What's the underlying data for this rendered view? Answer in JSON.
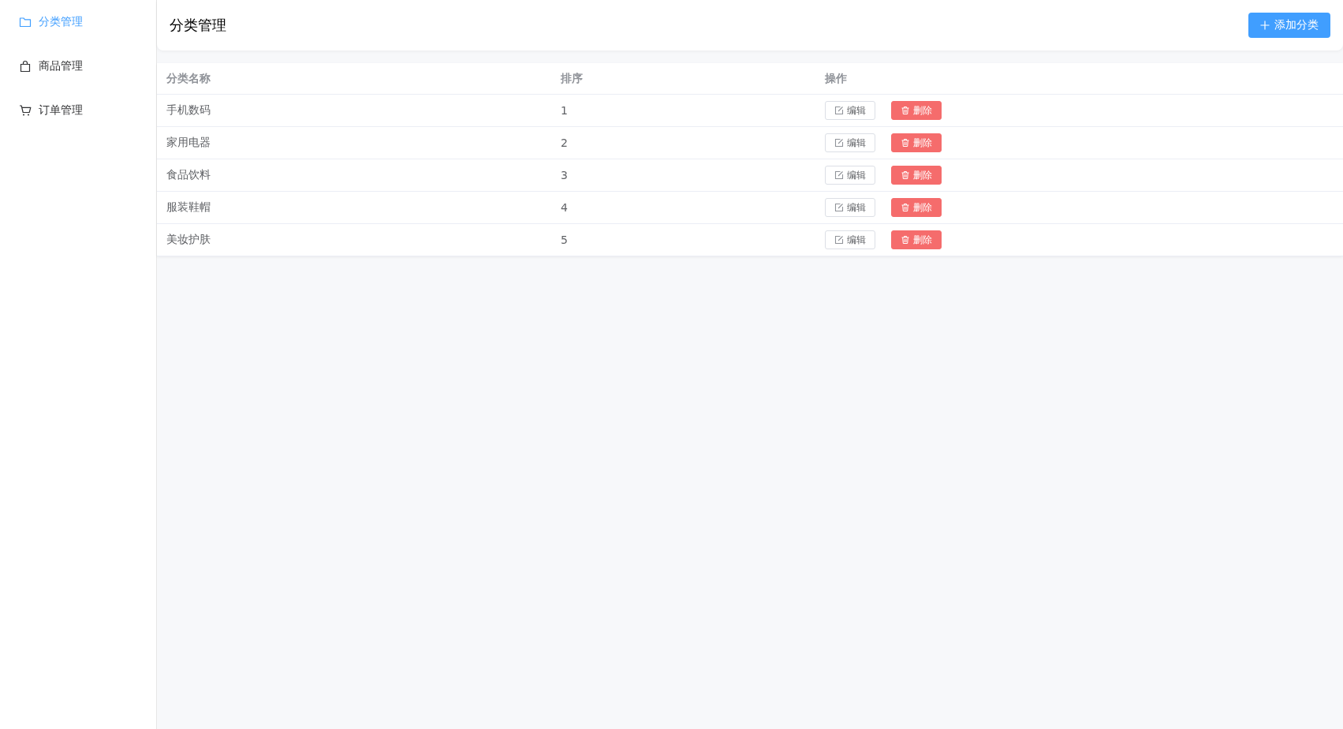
{
  "sidebar": {
    "items": [
      {
        "label": "分类管理",
        "selected": true
      },
      {
        "label": "商品管理",
        "selected": false
      },
      {
        "label": "订单管理",
        "selected": false
      }
    ]
  },
  "header": {
    "title": "分类管理",
    "add_button": "添加分类"
  },
  "table": {
    "columns": [
      "分类名称",
      "排序",
      "操作"
    ],
    "rows": [
      {
        "name": "手机数码",
        "sort": "1",
        "actions": [
          {
            "kind": "edit",
            "label": "编辑"
          },
          {
            "kind": "delete",
            "label": "删除"
          }
        ]
      },
      {
        "name": "家用电器",
        "sort": "2",
        "actions": [
          {
            "kind": "edit",
            "label": "编辑"
          },
          {
            "kind": "delete",
            "label": "删除"
          }
        ]
      },
      {
        "name": "食品饮料",
        "sort": "3",
        "actions": [
          {
            "kind": "edit",
            "label": "编辑"
          },
          {
            "kind": "delete",
            "label": "删除"
          }
        ]
      },
      {
        "name": "服装鞋帽",
        "sort": "4",
        "actions": [
          {
            "kind": "edit",
            "label": "编辑"
          },
          {
            "kind": "delete",
            "label": "删除"
          }
        ]
      },
      {
        "name": "美妆护肤",
        "sort": "5",
        "actions": [
          {
            "kind": "edit",
            "label": "编辑"
          },
          {
            "kind": "delete",
            "label": "删除"
          }
        ]
      }
    ]
  }
}
